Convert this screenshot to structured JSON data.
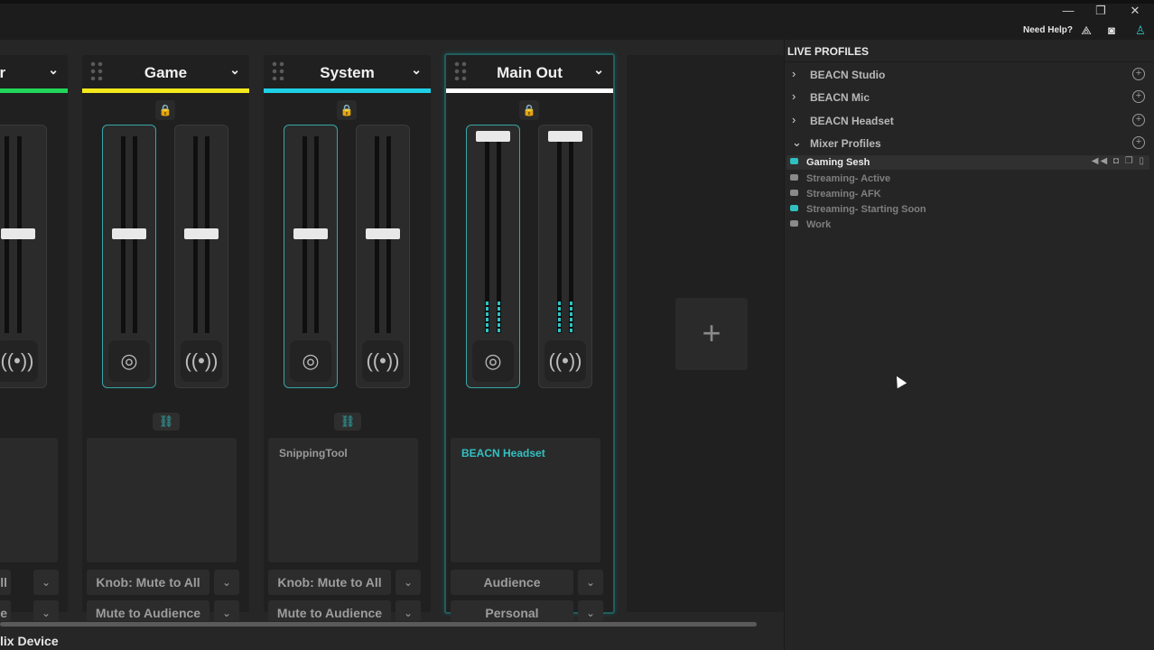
{
  "titlebar": {
    "minimize": "—",
    "restore": "❐",
    "close": "✕",
    "help_label": "Need Help?",
    "icons": [
      "beacn-logo-icon",
      "discord-icon",
      "profile-icon"
    ]
  },
  "channels": [
    {
      "title": "er",
      "color": "#22d65a"
    },
    {
      "title": "Game",
      "color": "#f4e81c"
    },
    {
      "title": "System",
      "color": "#1ed0e6"
    },
    {
      "title": "Main Out",
      "color": "#ffffff"
    }
  ],
  "apps": {
    "system": "SnippingTool",
    "main_out": "BEACN Headset"
  },
  "dropdowns": {
    "ch0_knob": "All",
    "ch0_mute": "nce",
    "game_knob": "Knob: Mute to All",
    "game_mute": "Mute to Audience",
    "system_knob": "Knob: Mute to All",
    "system_mute": "Mute to Audience",
    "main_top": "Audience",
    "main_bottom": "Personal"
  },
  "add_channel": "+",
  "device_label": "lix Device",
  "sidebar": {
    "title": "LIVE PROFILES",
    "groups": [
      {
        "label": "BEACN Studio",
        "expanded": false
      },
      {
        "label": "BEACN Mic",
        "expanded": false
      },
      {
        "label": "BEACN Headset",
        "expanded": false
      },
      {
        "label": "Mixer Profiles",
        "expanded": true
      }
    ],
    "profiles": [
      {
        "label": "Gaming Sesh",
        "selected": true,
        "icon_color": "#2fc0c0"
      },
      {
        "label": "Streaming- Active",
        "selected": false,
        "icon_color": "#8a8a8a"
      },
      {
        "label": "Streaming- AFK",
        "selected": false,
        "icon_color": "#8a8a8a"
      },
      {
        "label": "Streaming- Starting Soon",
        "selected": false,
        "icon_color": "#2fc0c0"
      },
      {
        "label": "Work",
        "selected": false,
        "icon_color": "#8a8a8a"
      }
    ],
    "profile_actions": "◀◀ ◘ ❐ ▯"
  },
  "colors": {
    "accent": "#2fc0c0",
    "background": "#232323"
  }
}
